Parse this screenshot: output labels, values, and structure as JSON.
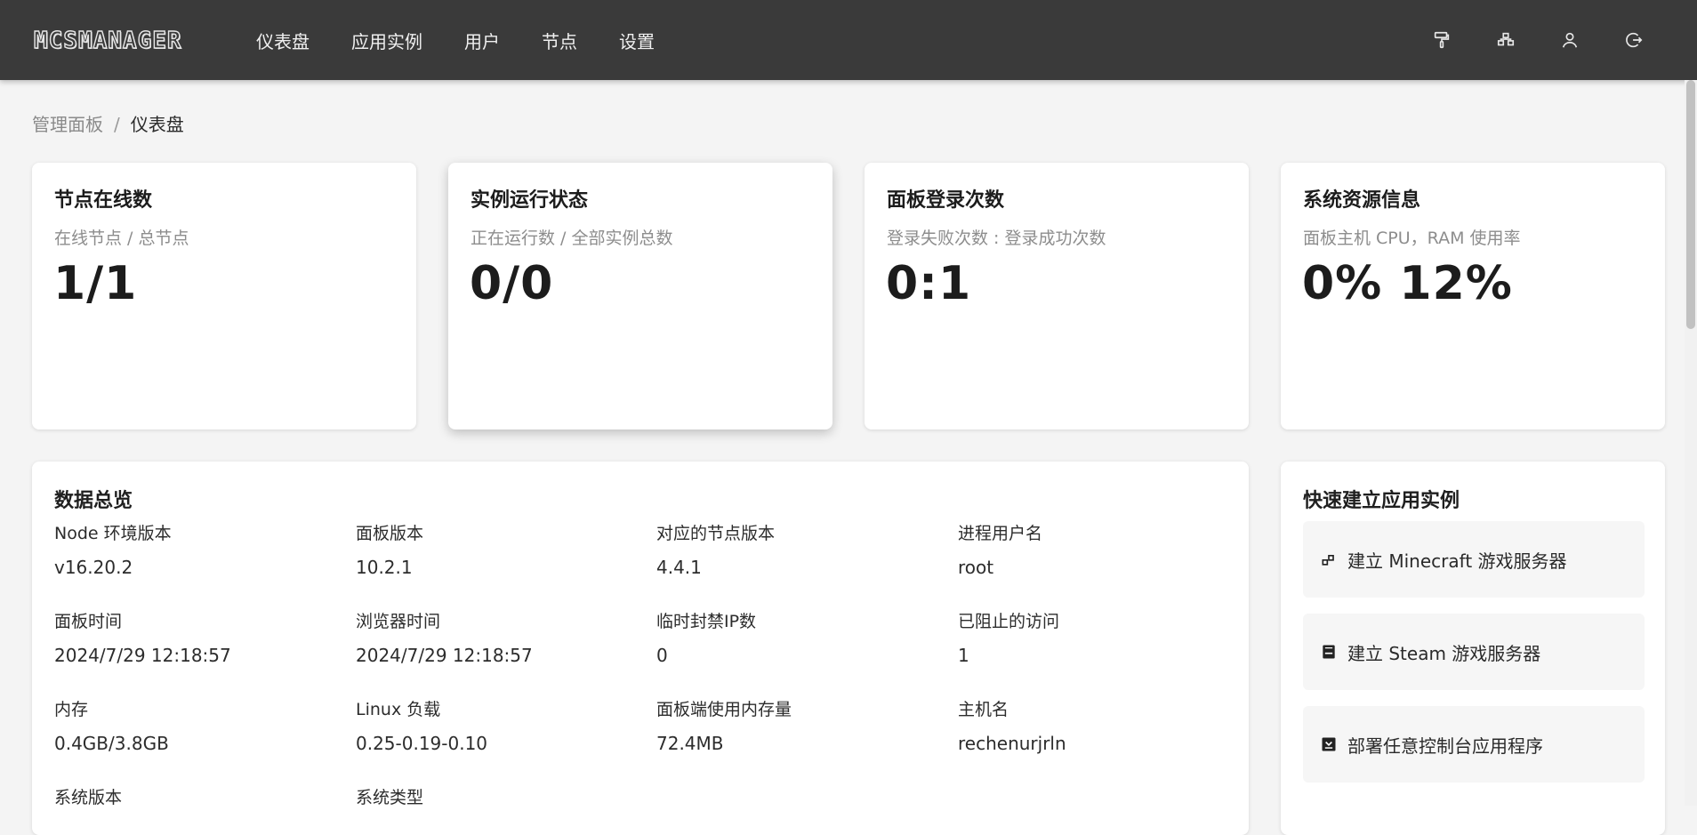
{
  "app": {
    "logo_text": "MCSMANAGER"
  },
  "nav": {
    "items": [
      {
        "label": "仪表盘"
      },
      {
        "label": "应用实例"
      },
      {
        "label": "用户"
      },
      {
        "label": "节点"
      },
      {
        "label": "设置"
      }
    ]
  },
  "toolbar_icons": [
    "paint-roller-icon",
    "cluster-icon",
    "user-icon",
    "logout-icon"
  ],
  "breadcrumb": {
    "parent": "管理面板",
    "separator": "/",
    "current": "仪表盘"
  },
  "stats": [
    {
      "title": "节点在线数",
      "subtitle": "在线节点 / 总节点",
      "value": "1/1"
    },
    {
      "title": "实例运行状态",
      "subtitle": "正在运行数 / 全部实例总数",
      "value": "0/0"
    },
    {
      "title": "面板登录次数",
      "subtitle": "登录失败次数 : 登录成功次数",
      "value": "0:1"
    },
    {
      "title": "系统资源信息",
      "subtitle": "面板主机 CPU，RAM 使用率",
      "value": "0% 12%"
    }
  ],
  "overview": {
    "title": "数据总览",
    "items": [
      {
        "label": "Node 环境版本",
        "value": "v16.20.2"
      },
      {
        "label": "面板版本",
        "value": "10.2.1"
      },
      {
        "label": "对应的节点版本",
        "value": "4.4.1"
      },
      {
        "label": "进程用户名",
        "value": "root"
      },
      {
        "label": "面板时间",
        "value": "2024/7/29 12:18:57"
      },
      {
        "label": "浏览器时间",
        "value": "2024/7/29 12:18:57"
      },
      {
        "label": "临时封禁IP数",
        "value": "0"
      },
      {
        "label": "已阻止的访问",
        "value": "1"
      },
      {
        "label": "内存",
        "value": "0.4GB/3.8GB"
      },
      {
        "label": "Linux 负载",
        "value": "0.25-0.19-0.10"
      },
      {
        "label": "面板端使用内存量",
        "value": "72.4MB"
      },
      {
        "label": "主机名",
        "value": "rechenurjrln"
      },
      {
        "label": "系统版本",
        "value": ""
      },
      {
        "label": "系统类型",
        "value": ""
      }
    ]
  },
  "quick_create": {
    "title": "快速建立应用实例",
    "items": [
      {
        "label": "建立 Minecraft 游戏服务器",
        "icon": "blocks-icon"
      },
      {
        "label": "建立 Steam 游戏服务器",
        "icon": "steam-box-icon"
      },
      {
        "label": "部署任意控制台应用程序",
        "icon": "download-box-icon"
      }
    ]
  }
}
